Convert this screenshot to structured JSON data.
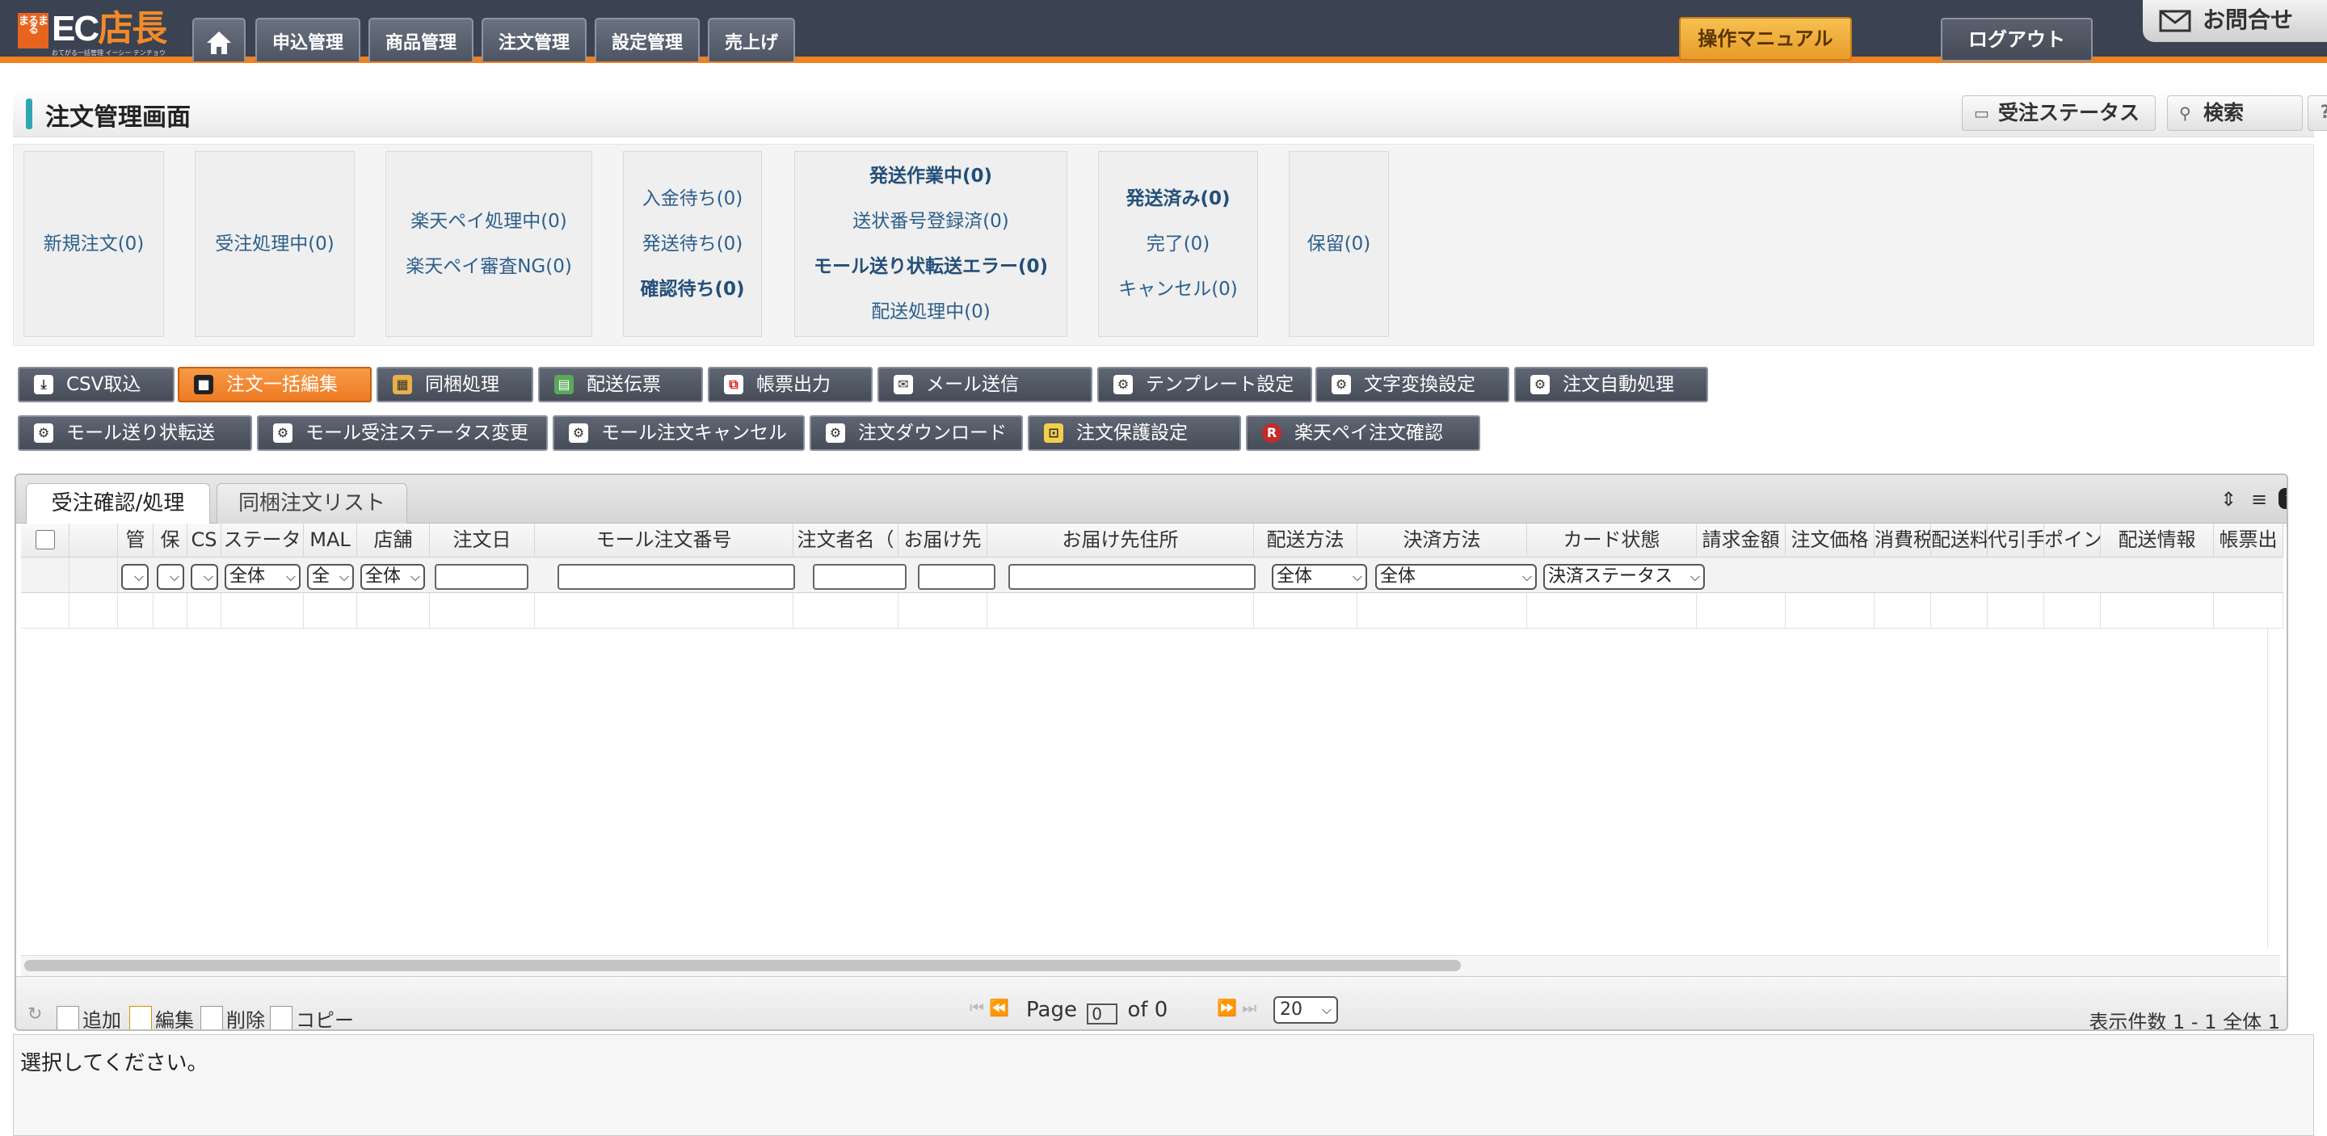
{
  "header": {
    "logo_badge": "まるまる",
    "logo_text": "EC",
    "logo_text2": "店長",
    "logo_tagline": "おてがる一括管理 イーシー テンチョウ",
    "nav": [
      "申込管理",
      "商品管理",
      "注文管理",
      "設定管理",
      "売上げ"
    ],
    "manual": "操作マニュアル",
    "logout": "ログアウト",
    "inquiry": "お問合せ"
  },
  "page": {
    "title": "注文管理画面",
    "order_status_btn": "受注ステータス",
    "search_btn": "検索",
    "help_btn": "?"
  },
  "status_groups": [
    [
      "新規注文(0)"
    ],
    [
      "受注処理中(0)"
    ],
    [
      "楽天ペイ処理中(0)",
      "楽天ペイ審査NG(0)"
    ],
    [
      "入金待ち(0)",
      "発送待ち(0)",
      "確認待ち(0)"
    ],
    [
      "発送作業中(0)",
      "送状番号登録済(0)",
      "モール送り状転送エラー(0)",
      "配送処理中(0)"
    ],
    [
      "発送済み(0)",
      "完了(0)",
      "キャンセル(0)"
    ],
    [
      "保留(0)"
    ]
  ],
  "actions_row1": [
    "CSV取込",
    "注文一括編集",
    "同梱処理",
    "配送伝票",
    "帳票出力",
    "メール送信",
    "テンプレート設定",
    "文字変換設定",
    "注文自動処理"
  ],
  "actions_row2": [
    "モール送り状転送",
    "モール受注ステータス変更",
    "モール注文キャンセル",
    "注文ダウンロード",
    "注文保護設定",
    "楽天ペイ注文確認"
  ],
  "grid": {
    "tabs": [
      "受注確認/処理",
      "同梱注文リスト"
    ],
    "columns": [
      "",
      "",
      "管",
      "保",
      "CS",
      "ステータ",
      "MAL",
      "店舗",
      "注文日",
      "モール注文番号",
      "注文者名（",
      "お届け先",
      "お届け先住所",
      "配送方法",
      "決済方法",
      "カード状態",
      "請求金額",
      "注文価格",
      "消費税",
      "配送料",
      "代引手",
      "ポイン",
      "配送情報",
      "帳票出"
    ],
    "filters": {
      "status": "全体",
      "mall": "全",
      "shop": "全体",
      "shipping": "全体",
      "payment": "全体",
      "card": "決済ステータス"
    }
  },
  "pager": {
    "add": "追加",
    "edit": "編集",
    "delete": "削除",
    "copy": "コピー",
    "page_label": "Page",
    "page_value": "0",
    "of_label": "of 0",
    "per_page": "20",
    "info": "表示件数 1 - 1 全体 1"
  },
  "message": "選択してください。"
}
